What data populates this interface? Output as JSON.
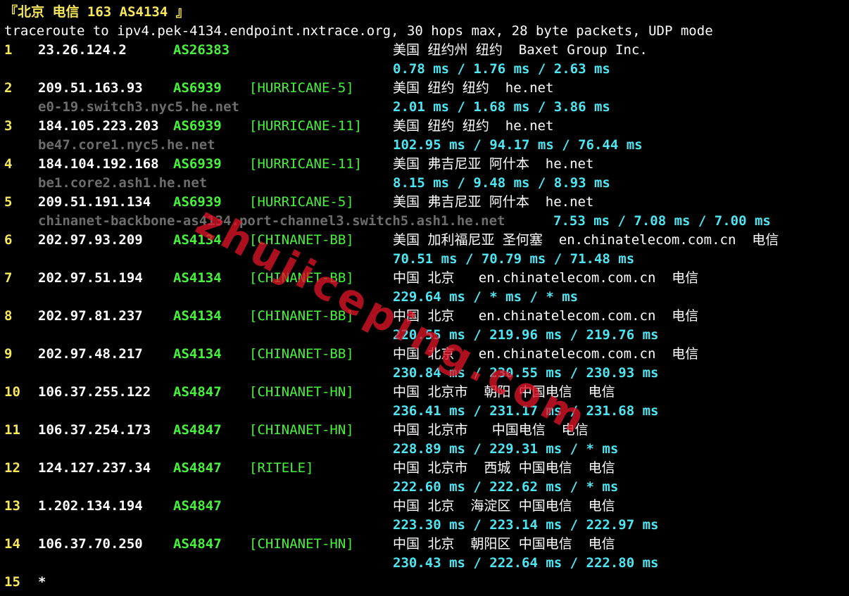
{
  "colors": {
    "background": "#000000",
    "hop_number": "#f6e85a",
    "ip": "#ffffff",
    "asn": "#47f23b",
    "rdns": "#6d6d6d",
    "rtt": "#4de6f2",
    "watermark": "#dc1428"
  },
  "header": "『北京 电信 163 AS4134 』",
  "command_line": "traceroute to ipv4.pek-4134.endpoint.nxtrace.org, 30 hops max, 28 byte packets, UDP mode",
  "watermark": "zhujiceping.com",
  "hops": [
    {
      "num": "1",
      "ip": "23.26.124.2",
      "asn": "AS26383",
      "tag": "",
      "geo": "美国 纽约州 纽约  Baxet Group Inc.",
      "rdns": "",
      "rtt": "0.78 ms / 1.76 ms / 2.63 ms"
    },
    {
      "num": "2",
      "ip": "209.51.163.93",
      "asn": "AS6939",
      "tag": "[HURRICANE-5]",
      "geo": "美国 纽约 纽约  he.net",
      "rdns": "e0-19.switch3.nyc5.he.net",
      "rtt": "2.01 ms / 1.68 ms / 3.86 ms"
    },
    {
      "num": "3",
      "ip": "184.105.223.203",
      "asn": "AS6939",
      "tag": "[HURRICANE-11]",
      "geo": "美国 纽约 纽约  he.net",
      "rdns": "be47.core1.nyc5.he.net",
      "rtt": "102.95 ms / 94.17 ms / 76.44 ms"
    },
    {
      "num": "4",
      "ip": "184.104.192.168",
      "asn": "AS6939",
      "tag": "[HURRICANE-11]",
      "geo": "美国 弗吉尼亚 阿什本  he.net",
      "rdns": "be1.core2.ash1.he.net",
      "rtt": "8.15 ms / 9.48 ms / 8.93 ms"
    },
    {
      "num": "5",
      "ip": "209.51.191.134",
      "asn": "AS6939",
      "tag": "[HURRICANE-5]",
      "geo": "美国 弗吉尼亚 阿什本  he.net",
      "rdns": "chinanet-backbone-as4134.port-channel3.switch5.ash1.he.net",
      "rtt": "7.53 ms / 7.08 ms / 7.00 ms"
    },
    {
      "num": "6",
      "ip": "202.97.93.209",
      "asn": "AS4134",
      "tag": "[CHINANET-BB]",
      "geo": "美国 加利福尼亚 圣何塞  en.chinatelecom.com.cn  电信",
      "rdns": "",
      "rtt": "70.51 ms / 70.79 ms / 71.48 ms"
    },
    {
      "num": "7",
      "ip": "202.97.51.194",
      "asn": "AS4134",
      "tag": "[CHINANET-BB]",
      "geo": "中国 北京   en.chinatelecom.com.cn  电信",
      "rdns": "",
      "rtt": "229.64 ms / * ms / * ms"
    },
    {
      "num": "8",
      "ip": "202.97.81.237",
      "asn": "AS4134",
      "tag": "[CHINANET-BB]",
      "geo": "中国 北京   en.chinatelecom.com.cn  电信",
      "rdns": "",
      "rtt": "220.55 ms / 219.96 ms / 219.76 ms"
    },
    {
      "num": "9",
      "ip": "202.97.48.217",
      "asn": "AS4134",
      "tag": "[CHINANET-BB]",
      "geo": "中国 北京   en.chinatelecom.com.cn  电信",
      "rdns": "",
      "rtt": "230.84 ms / 230.55 ms / 230.93 ms"
    },
    {
      "num": "10",
      "ip": "106.37.255.122",
      "asn": "AS4847",
      "tag": "[CHINANET-HN]",
      "geo": "中国 北京市  朝阳 中国电信  电信",
      "rdns": "",
      "rtt": "236.41 ms / 231.17 ms / 231.68 ms"
    },
    {
      "num": "11",
      "ip": "106.37.254.173",
      "asn": "AS4847",
      "tag": "[CHINANET-HN]",
      "geo": "中国 北京市   中国电信  电信",
      "rdns": "",
      "rtt": "228.89 ms / 229.31 ms / * ms"
    },
    {
      "num": "12",
      "ip": "124.127.237.34",
      "asn": "AS4847",
      "tag": "[RITELE]",
      "geo": "中国 北京市  西城 中国电信  电信",
      "rdns": "",
      "rtt": "222.60 ms / 222.62 ms / * ms"
    },
    {
      "num": "13",
      "ip": "1.202.134.194",
      "asn": "AS4847",
      "tag": "",
      "geo": "中国 北京  海淀区 中国电信  电信",
      "rdns": "",
      "rtt": "223.30 ms / 223.14 ms / 222.97 ms"
    },
    {
      "num": "14",
      "ip": "106.37.70.250",
      "asn": "AS4847",
      "tag": "[CHINANET-HN]",
      "geo": "中国 北京  朝阳区 中国电信  电信",
      "rdns": "",
      "rtt": "230.43 ms / 222.64 ms / 222.80 ms"
    }
  ],
  "final_hop": {
    "num": "15",
    "value": "*"
  }
}
